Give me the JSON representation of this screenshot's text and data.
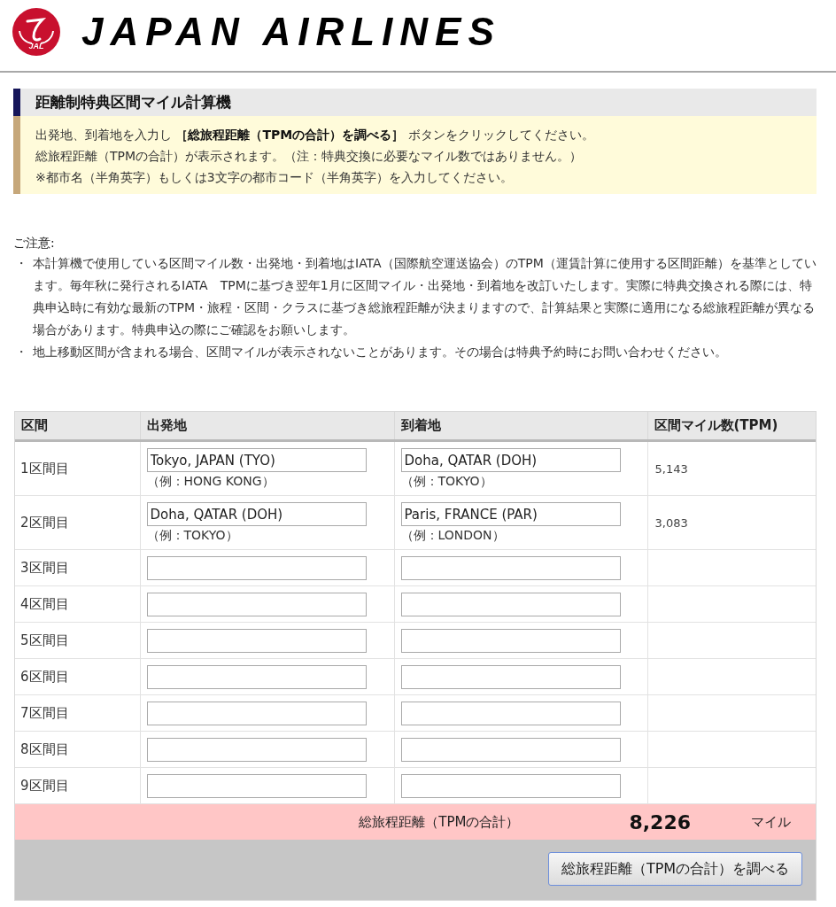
{
  "header": {
    "logo_text": "JAL",
    "brand": "JAPAN AIRLINES"
  },
  "calculator": {
    "title": "距離制特典区間マイル計算機",
    "instructions": [
      "出発地、到着地を入力し **［総旅程距離（TPMの合計）を調べる］** ボタンをクリックしてください。",
      "総旅程距離（TPMの合計）が表示されます。（注：特典交換に必要なマイル数ではありません。）",
      "※都市名（半角英字）もしくは3文字の都市コード（半角英字）を入力してください。"
    ]
  },
  "notice": {
    "heading": "ご注意:",
    "items": [
      {
        "bullet": "・",
        "text": "本計算機で使用している区間マイル数・出発地・到着地はIATA（国際航空運送協会）のTPM（運賃計算に使用する区間距離）を基準としています。毎年秋に発行されるIATA　TPMに基づき翌年1月に区間マイル・出発地・到着地を改訂いたします。実際に特典交換される際には、特典申込時に有効な最新のTPM・旅程・区間・クラスに基づき総旅程距離が決まりますので、計算結果と実際に適用になる総旅程距離が異なる場合があります。特典申込の際にご確認をお願いします。"
      },
      {
        "bullet": "・",
        "text": "地上移動区間が含まれる場合、区間マイルが表示されないことがあります。その場合は特典予約時にお問い合わせください。"
      }
    ]
  },
  "route_table": {
    "columns": [
      "区間",
      "出発地",
      "到着地",
      "区間マイル数(TPM)"
    ],
    "rows": [
      {
        "segment": "1区間目",
        "origin": {
          "value": "Tokyo, JAPAN (TYO)",
          "example": "（例：HONG KONG）"
        },
        "destination": {
          "value": "Doha, QATAR (DOH)",
          "example": "（例：TOKYO）"
        },
        "tpm": "5,143"
      },
      {
        "segment": "2区間目",
        "origin": {
          "value": "Doha, QATAR (DOH)",
          "example": "（例：TOKYO）"
        },
        "destination": {
          "value": "Paris, FRANCE (PAR)",
          "example": "（例：LONDON）"
        },
        "tpm": "3,083"
      },
      {
        "segment": "3区間目"
      },
      {
        "segment": "4区間目"
      },
      {
        "segment": "5区間目"
      },
      {
        "segment": "6区間目"
      },
      {
        "segment": "7区間目"
      },
      {
        "segment": "8区間目"
      },
      {
        "segment": "9区間目"
      }
    ]
  },
  "total": {
    "label": "総旅程距離（TPMの合計）",
    "value": "8,226",
    "unit": "マイル"
  },
  "button": "総旅程距離（TPMの合計）を調べる"
}
